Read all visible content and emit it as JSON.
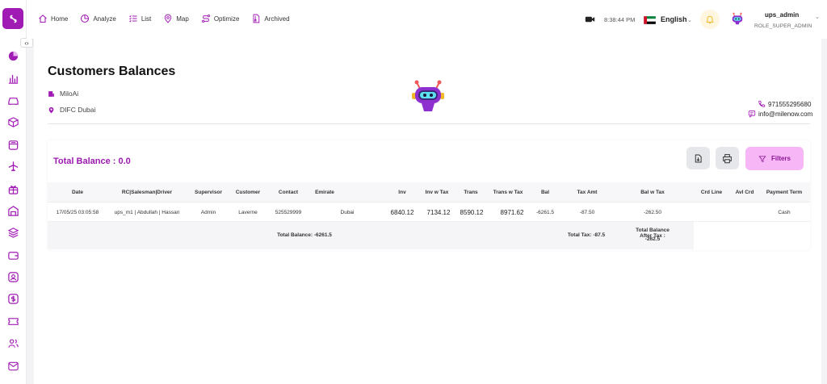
{
  "nav": {
    "home": "Home",
    "analyze": "Analyze",
    "list": "List",
    "map": "Map",
    "optimize": "Optimize",
    "archived": "Archived"
  },
  "header": {
    "time": "8:38:44 PM",
    "language": "English",
    "user_name": "ups_admin",
    "user_role": "ROLE_SUPER_ADMIN"
  },
  "page": {
    "title": "Customers Balances",
    "company": "MiloAi",
    "address": "DIFC Dubai",
    "phone": "971555295680",
    "email": "info@milenow.com"
  },
  "summary": {
    "total_balance": "Total Balance : 0.0",
    "filters_label": "Filters"
  },
  "table": {
    "headers": [
      "Date",
      "RC|Salesman|Driver",
      "Supervisor",
      "Customer",
      "Contact",
      "Emirate",
      "Inv",
      "Inv w Tax",
      "Trans",
      "Trans w Tax",
      "Bal",
      "Tax Amt",
      "Bal w Tax",
      "Crd Line",
      "Avl Crd",
      "Payment Term"
    ],
    "rows": [
      {
        "date": "17/05/25 03:05:58",
        "rc": "ups_m1 | Abdullah | Hassan",
        "supervisor": "Admin",
        "customer": "Laverne",
        "contact": "525529999",
        "emirate": "Dubai",
        "inv": "6840.12",
        "inv_tax": "7134.12",
        "trans": "8590.12",
        "trans_tax": "8971.62",
        "bal": "-6261.5",
        "tax_amt": "-87.50",
        "bal_tax": "-262.50",
        "crd_line": "",
        "avl_crd": "",
        "payment_term": "Cash"
      }
    ],
    "footer": {
      "total_balance": "Total Balance: -6261.5",
      "total_tax": "Total Tax: -87.5",
      "after_tax_label": "Total Balance After Tax :",
      "after_tax_value": "-262.5"
    }
  },
  "colors": {
    "brand": "#a01ab4",
    "filter_bg": "#f7b6f6"
  }
}
